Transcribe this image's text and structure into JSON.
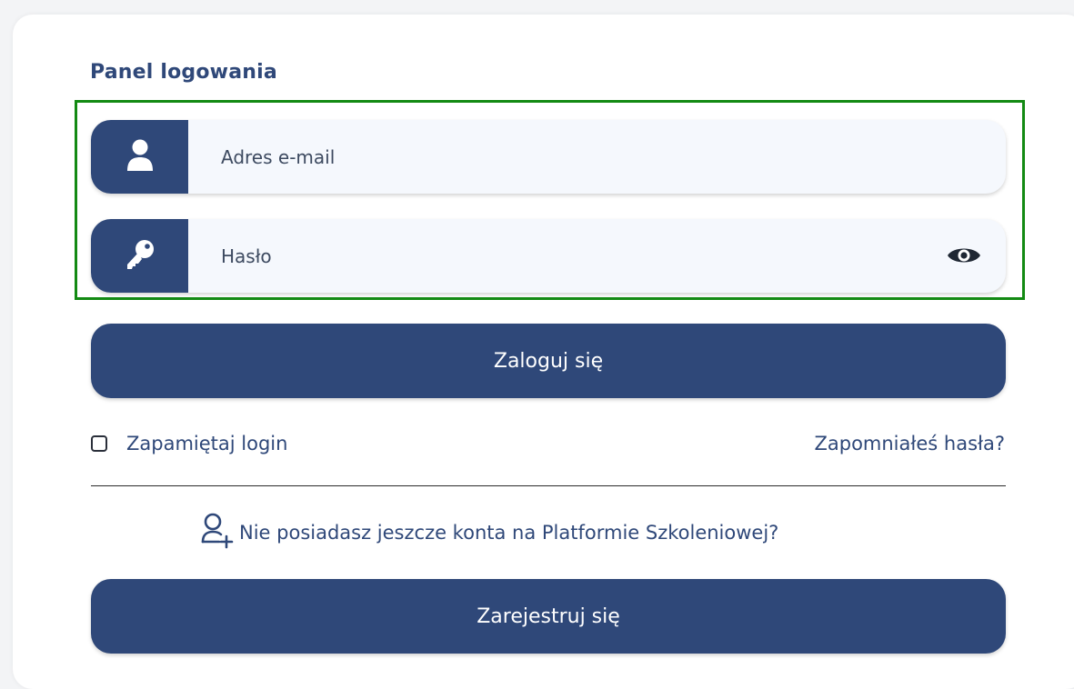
{
  "colors": {
    "primary": "#2f4879",
    "focus_outline": "#138a13",
    "field_background": "#f5f8fd",
    "card_background": "#ffffff"
  },
  "panel": {
    "title": "Panel logowania"
  },
  "email_field": {
    "icon": "user-icon",
    "placeholder": "Adres e-mail",
    "value": ""
  },
  "password_field": {
    "icon": "key-icon",
    "placeholder": "Hasło",
    "value": "",
    "toggle_icon": "eye-icon"
  },
  "login_button": {
    "label": "Zaloguj się"
  },
  "remember": {
    "label": "Zapamiętaj login",
    "checked": false
  },
  "forgot_link": {
    "label": "Zapomniałeś hasła?"
  },
  "register_prompt": {
    "icon": "add-user-icon",
    "text": "Nie posiadasz jeszcze konta na Platformie Szkoleniowej?"
  },
  "register_button": {
    "label": "Zarejestruj się"
  }
}
